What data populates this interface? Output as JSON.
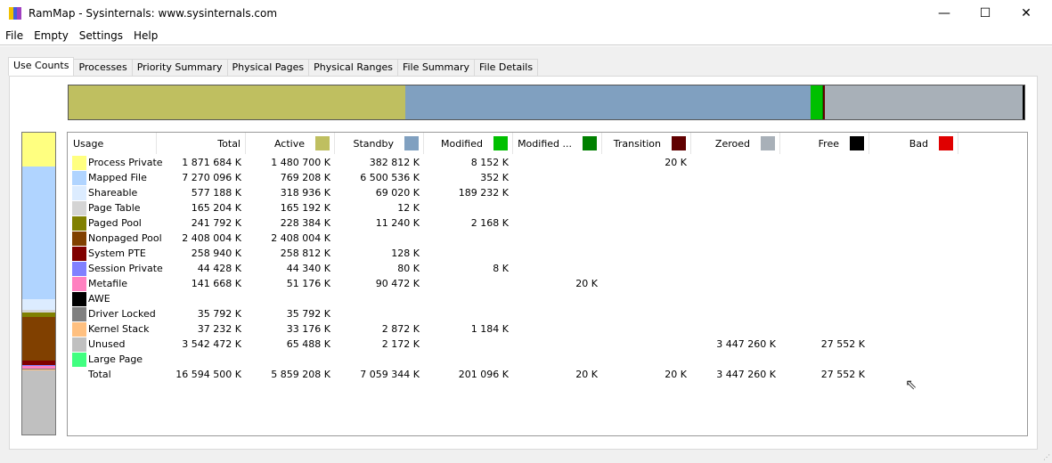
{
  "window": {
    "title": "RamMap - Sysinternals: www.sysinternals.com",
    "minimize": "—",
    "maximize": "☐",
    "close": "✕"
  },
  "menu": [
    "File",
    "Empty",
    "Settings",
    "Help"
  ],
  "tabs": [
    "Use Counts",
    "Processes",
    "Priority Summary",
    "Physical Pages",
    "Physical Ranges",
    "File Summary",
    "File Details"
  ],
  "columns": [
    {
      "label": "Usage"
    },
    {
      "label": "Total"
    },
    {
      "label": "Active",
      "color": "#bfbf60"
    },
    {
      "label": "Standby",
      "color": "#80a0c0"
    },
    {
      "label": "Modified",
      "color": "#00c000"
    },
    {
      "label": "Modified ...",
      "color": "#008000"
    },
    {
      "label": "Transition",
      "color": "#600000"
    },
    {
      "label": "Zeroed",
      "color": "#a8b0b8"
    },
    {
      "label": "Free",
      "color": "#000000"
    },
    {
      "label": "Bad",
      "color": "#e00000"
    }
  ],
  "rows": [
    {
      "usage": "Process Private",
      "color": "#ffff80",
      "total_k": 1871684,
      "values": [
        "1 871 684 K",
        "1 480 700 K",
        "382 812 K",
        "8 152 K",
        "",
        "20 K",
        "",
        "",
        ""
      ]
    },
    {
      "usage": "Mapped File",
      "color": "#b0d4ff",
      "total_k": 7270096,
      "values": [
        "7 270 096 K",
        "769 208 K",
        "6 500 536 K",
        "352 K",
        "",
        "",
        "",
        "",
        ""
      ]
    },
    {
      "usage": "Shareable",
      "color": "#dcecff",
      "total_k": 577188,
      "values": [
        "577 188 K",
        "318 936 K",
        "69 020 K",
        "189 232 K",
        "",
        "",
        "",
        "",
        ""
      ]
    },
    {
      "usage": "Page Table",
      "color": "#d4d4d4",
      "total_k": 165204,
      "values": [
        "165 204 K",
        "165 192 K",
        "12 K",
        "",
        "",
        "",
        "",
        "",
        ""
      ]
    },
    {
      "usage": "Paged Pool",
      "color": "#808000",
      "total_k": 241792,
      "values": [
        "241 792 K",
        "228 384 K",
        "11 240 K",
        "2 168 K",
        "",
        "",
        "",
        "",
        ""
      ]
    },
    {
      "usage": "Nonpaged Pool",
      "color": "#804000",
      "total_k": 2408004,
      "values": [
        "2 408 004 K",
        "2 408 004 K",
        "",
        "",
        "",
        "",
        "",
        "",
        ""
      ]
    },
    {
      "usage": "System PTE",
      "color": "#800000",
      "total_k": 258940,
      "values": [
        "258 940 K",
        "258 812 K",
        "128 K",
        "",
        "",
        "",
        "",
        "",
        ""
      ]
    },
    {
      "usage": "Session Private",
      "color": "#8080ff",
      "total_k": 44428,
      "values": [
        "44 428 K",
        "44 340 K",
        "80 K",
        "8 K",
        "",
        "",
        "",
        "",
        ""
      ]
    },
    {
      "usage": "Metafile",
      "color": "#ff80c0",
      "total_k": 141668,
      "values": [
        "141 668 K",
        "51 176 K",
        "90 472 K",
        "",
        "20 K",
        "",
        "",
        "",
        ""
      ]
    },
    {
      "usage": "AWE",
      "color": "#000000",
      "total_k": 0,
      "values": [
        "",
        "",
        "",
        "",
        "",
        "",
        "",
        "",
        ""
      ]
    },
    {
      "usage": "Driver Locked",
      "color": "#808080",
      "total_k": 35792,
      "values": [
        "35 792 K",
        "35 792 K",
        "",
        "",
        "",
        "",
        "",
        "",
        ""
      ]
    },
    {
      "usage": "Kernel Stack",
      "color": "#ffc080",
      "total_k": 37232,
      "values": [
        "37 232 K",
        "33 176 K",
        "2 872 K",
        "1 184 K",
        "",
        "",
        "",
        "",
        ""
      ]
    },
    {
      "usage": "Unused",
      "color": "#c0c0c0",
      "total_k": 3542472,
      "values": [
        "3 542 472 K",
        "65 488 K",
        "2 172 K",
        "",
        "",
        "",
        "3 447 260 K",
        "27 552 K",
        ""
      ]
    },
    {
      "usage": "Large Page",
      "color": "#40ff80",
      "total_k": 0,
      "values": [
        "",
        "",
        "",
        "",
        "",
        "",
        "",
        "",
        ""
      ]
    }
  ],
  "total_row": {
    "usage": "Total",
    "values": [
      "16 594 500 K",
      "5 859 208 K",
      "7 059 344 K",
      "201 096 K",
      "20 K",
      "20 K",
      "3 447 260 K",
      "27 552 K",
      ""
    ]
  },
  "summary_bar": [
    {
      "name": "Active",
      "k": 5859208,
      "color": "#bfbf60"
    },
    {
      "name": "Standby",
      "k": 7059344,
      "color": "#80a0c0"
    },
    {
      "name": "Modified",
      "k": 201096,
      "color": "#00c000"
    },
    {
      "name": "Modified no write",
      "k": 20,
      "color": "#008000"
    },
    {
      "name": "Transition",
      "k": 20,
      "color": "#600000"
    },
    {
      "name": "Zeroed",
      "k": 3447260,
      "color": "#a8b0b8"
    },
    {
      "name": "Free",
      "k": 27552,
      "color": "#000000"
    }
  ]
}
